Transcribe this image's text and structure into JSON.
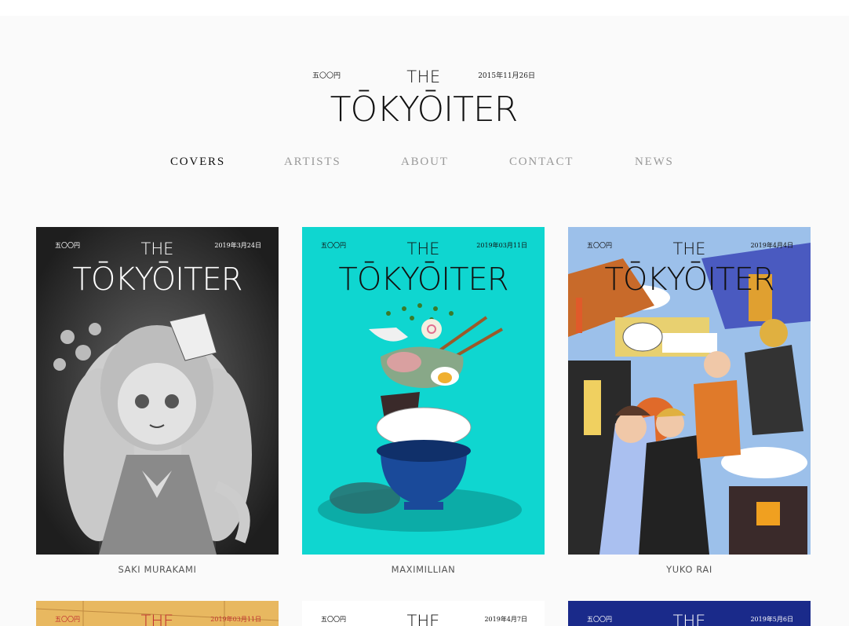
{
  "masthead": {
    "price": "五〇〇円",
    "date": "2015年11月26日",
    "the": "THE",
    "name": "TŌKYŌITER"
  },
  "nav": [
    {
      "label": "COVERS",
      "active": true
    },
    {
      "label": "ARTISTS",
      "active": false
    },
    {
      "label": "ABOUT",
      "active": false
    },
    {
      "label": "CONTACT",
      "active": false
    },
    {
      "label": "NEWS",
      "active": false
    }
  ],
  "covers": [
    {
      "price": "五〇〇円",
      "date": "2019年3月24日",
      "the": "THE",
      "name": "TŌKYŌITER",
      "artist": "SAKI MURAKAMI",
      "bg": "#2b2b2b",
      "ink": "#ffffff"
    },
    {
      "price": "五〇〇円",
      "date": "2019年03月11日",
      "the": "THE",
      "name": "TŌKYŌITER",
      "artist": "MAXIMILLIAN",
      "bg": "#0fd6d0",
      "ink": "#111111"
    },
    {
      "price": "五〇〇円",
      "date": "2019年4月4日",
      "the": "THE",
      "name": "TŌKYŌITER",
      "artist": "YUKO RAI",
      "bg": "#8fb3e0",
      "ink": "#111111"
    },
    {
      "price": "五〇〇円",
      "date": "2019年03月11日",
      "the": "THE",
      "artist": "",
      "bg": "#e8b860",
      "ink": "#c03030"
    },
    {
      "price": "五〇〇円",
      "date": "2019年4月7日",
      "the": "THE",
      "artist": "",
      "bg": "#ffffff",
      "ink": "#111111"
    },
    {
      "price": "五〇〇円",
      "date": "2019年5月6日",
      "the": "THE",
      "artist": "",
      "bg": "#1a2a8a",
      "ink": "#ffffff"
    }
  ]
}
